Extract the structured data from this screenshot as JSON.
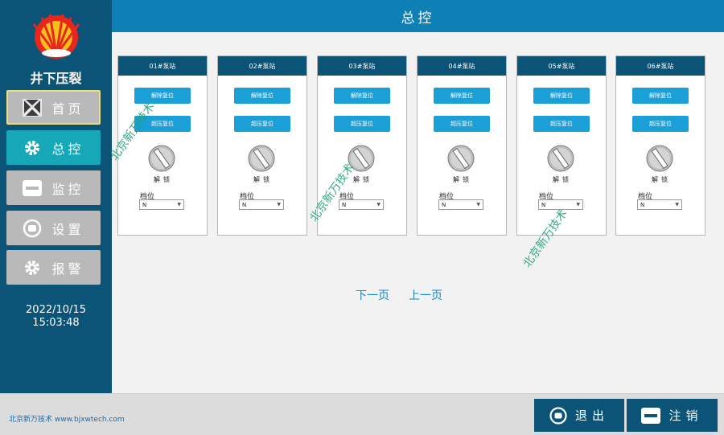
{
  "app": {
    "title": "井下压裂"
  },
  "header": {
    "title": "总控"
  },
  "nav": {
    "home": "首页",
    "control": "总控",
    "monitor": "监控",
    "settings": "设置",
    "alarm": "报警"
  },
  "clock": {
    "date": "2022/10/15",
    "time": "15:03:48"
  },
  "stations": [
    {
      "name": "01#泵站",
      "btn_release": "解除复位",
      "btn_pressure": "超压复位",
      "lock": "解锁",
      "gear_label": "档位",
      "gear_value": "N"
    },
    {
      "name": "02#泵站",
      "btn_release": "解除复位",
      "btn_pressure": "超压复位",
      "lock": "解锁",
      "gear_label": "档位",
      "gear_value": "N"
    },
    {
      "name": "03#泵站",
      "btn_release": "解除复位",
      "btn_pressure": "超压复位",
      "lock": "解锁",
      "gear_label": "档位",
      "gear_value": "N"
    },
    {
      "name": "04#泵站",
      "btn_release": "解除复位",
      "btn_pressure": "超压复位",
      "lock": "解锁",
      "gear_label": "档位",
      "gear_value": "N"
    },
    {
      "name": "05#泵站",
      "btn_release": "解除复位",
      "btn_pressure": "超压复位",
      "lock": "解锁",
      "gear_label": "档位",
      "gear_value": "N"
    },
    {
      "name": "06#泵站",
      "btn_release": "解除复位",
      "btn_pressure": "超压复位",
      "lock": "解锁",
      "gear_label": "档位",
      "gear_value": "N"
    }
  ],
  "pagination": {
    "next": "下一页",
    "prev": "上一页"
  },
  "watermark": "北京新万技术",
  "footer": {
    "company": "北京新万技术  www.bjxwtech.com",
    "exit": "退出",
    "logout": "注销"
  },
  "colors": {
    "sidebar": "#0b5478",
    "header": "#0e80b5",
    "accent": "#16a7b8",
    "button": "#1a9fd6",
    "nav_inactive": "#b9b9b9"
  }
}
